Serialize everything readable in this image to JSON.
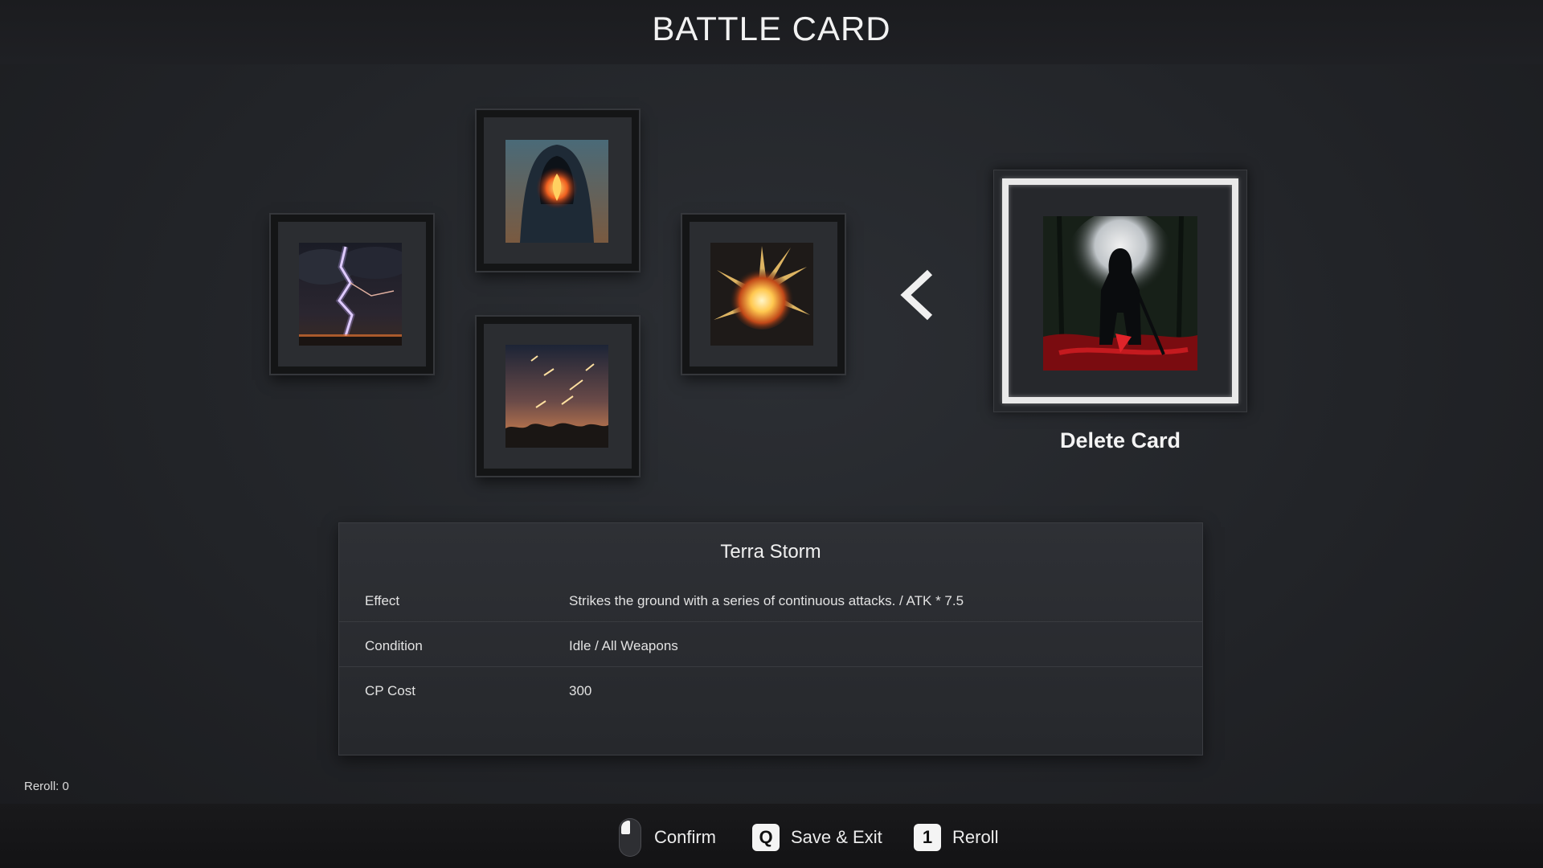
{
  "header": {
    "title": "BATTLE CARD"
  },
  "cards": [
    {
      "art": "lightning-storm-art"
    },
    {
      "art": "hooded-fire-figure-art"
    },
    {
      "art": "meteor-shower-art"
    },
    {
      "art": "fiery-explosion-art"
    }
  ],
  "selected_card": {
    "art": "dark-knight-art",
    "label": "Delete Card"
  },
  "details": {
    "name": "Terra Storm",
    "rows": [
      {
        "label": "Effect",
        "value": "Strikes the ground with a series of continuous attacks. / ATK * 7.5"
      },
      {
        "label": "Condition",
        "value": "Idle / All Weapons"
      },
      {
        "label": "CP Cost",
        "value": "300"
      }
    ]
  },
  "status": {
    "reroll_count": "Reroll: 0"
  },
  "controls": {
    "confirm_label": "Confirm",
    "save_key": "Q",
    "save_label": "Save & Exit",
    "reroll_key": "1",
    "reroll_label": "Reroll"
  },
  "colors": {
    "background": "#222428",
    "highlight_frame": "#e9e9e9",
    "accent_red": "#b5121b"
  }
}
